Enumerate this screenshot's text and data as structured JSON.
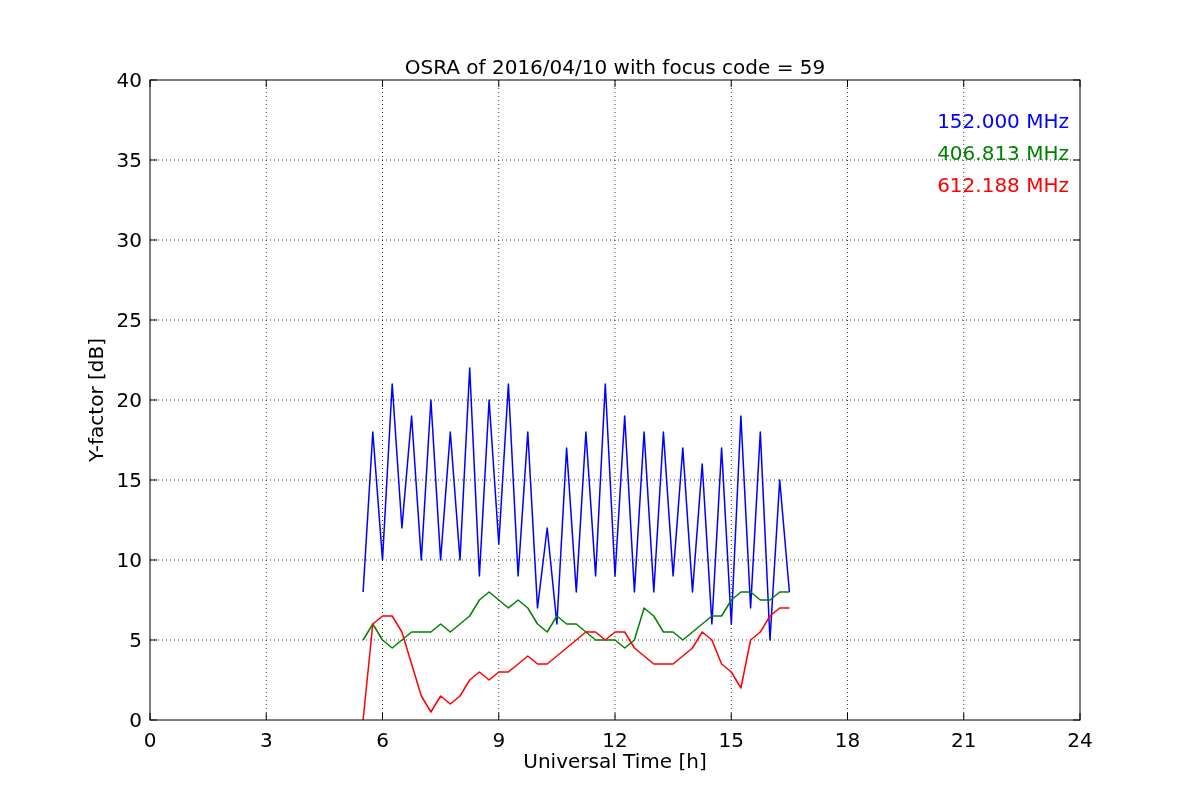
{
  "chart_data": {
    "type": "line",
    "title": "OSRA of 2016/04/10 with focus code = 59",
    "xlabel": "Universal Time [h]",
    "ylabel": "Y-factor [dB]",
    "x": [
      5.5,
      5.75,
      6,
      6.25,
      6.5,
      6.75,
      7,
      7.25,
      7.5,
      7.75,
      8,
      8.25,
      8.5,
      8.75,
      9,
      9.25,
      9.5,
      9.75,
      10,
      10.25,
      10.5,
      10.75,
      11,
      11.25,
      11.5,
      11.75,
      12,
      12.25,
      12.5,
      12.75,
      13,
      13.25,
      13.5,
      13.75,
      14,
      14.25,
      14.5,
      14.75,
      15,
      15.25,
      15.5,
      15.75,
      16,
      16.25,
      16.5
    ],
    "grid": true,
    "xlim": [
      0,
      24
    ],
    "ylim": [
      0,
      40
    ],
    "xticks": [
      0,
      3,
      6,
      9,
      12,
      15,
      18,
      21,
      24
    ],
    "yticks": [
      0,
      5,
      10,
      15,
      20,
      25,
      30,
      35,
      40
    ],
    "series": [
      {
        "name": "152.000 MHz",
        "color": "#0000ff",
        "values": [
          8,
          18,
          10,
          21,
          12,
          19,
          10,
          20,
          10,
          18,
          10,
          22,
          9,
          20,
          11,
          21,
          9,
          18,
          7,
          12,
          6,
          17,
          8,
          18,
          9,
          21,
          9,
          19,
          8,
          18,
          8,
          18,
          9,
          17,
          8,
          16,
          6,
          17,
          6,
          19,
          7,
          18,
          5,
          15,
          8
        ]
      },
      {
        "name": "406.813 MHz",
        "color": "#008000",
        "values": [
          5,
          6,
          5,
          4.5,
          5,
          5.5,
          5.5,
          5.5,
          6,
          5.5,
          6,
          6.5,
          7.5,
          8,
          7.5,
          7,
          7.5,
          7,
          6,
          5.5,
          6.5,
          6,
          6,
          5.5,
          5,
          5,
          5,
          4.5,
          5,
          7,
          6.5,
          5.5,
          5.5,
          5,
          5.5,
          6,
          6.5,
          6.5,
          7.5,
          8,
          8,
          7.5,
          7.5,
          8,
          8
        ]
      },
      {
        "name": "612.188 MHz",
        "color": "#ff0000",
        "values": [
          0,
          6,
          6.5,
          6.5,
          5.5,
          3.5,
          1.5,
          0.5,
          1.5,
          1,
          1.5,
          2.5,
          3,
          2.5,
          3,
          3,
          3.5,
          4,
          3.5,
          3.5,
          4,
          4.5,
          5,
          5.5,
          5.5,
          5,
          5.5,
          5.5,
          4.5,
          4,
          3.5,
          3.5,
          3.5,
          4,
          4.5,
          5.5,
          5,
          3.5,
          3,
          2,
          5,
          5.5,
          6.5,
          7,
          7
        ]
      }
    ]
  }
}
